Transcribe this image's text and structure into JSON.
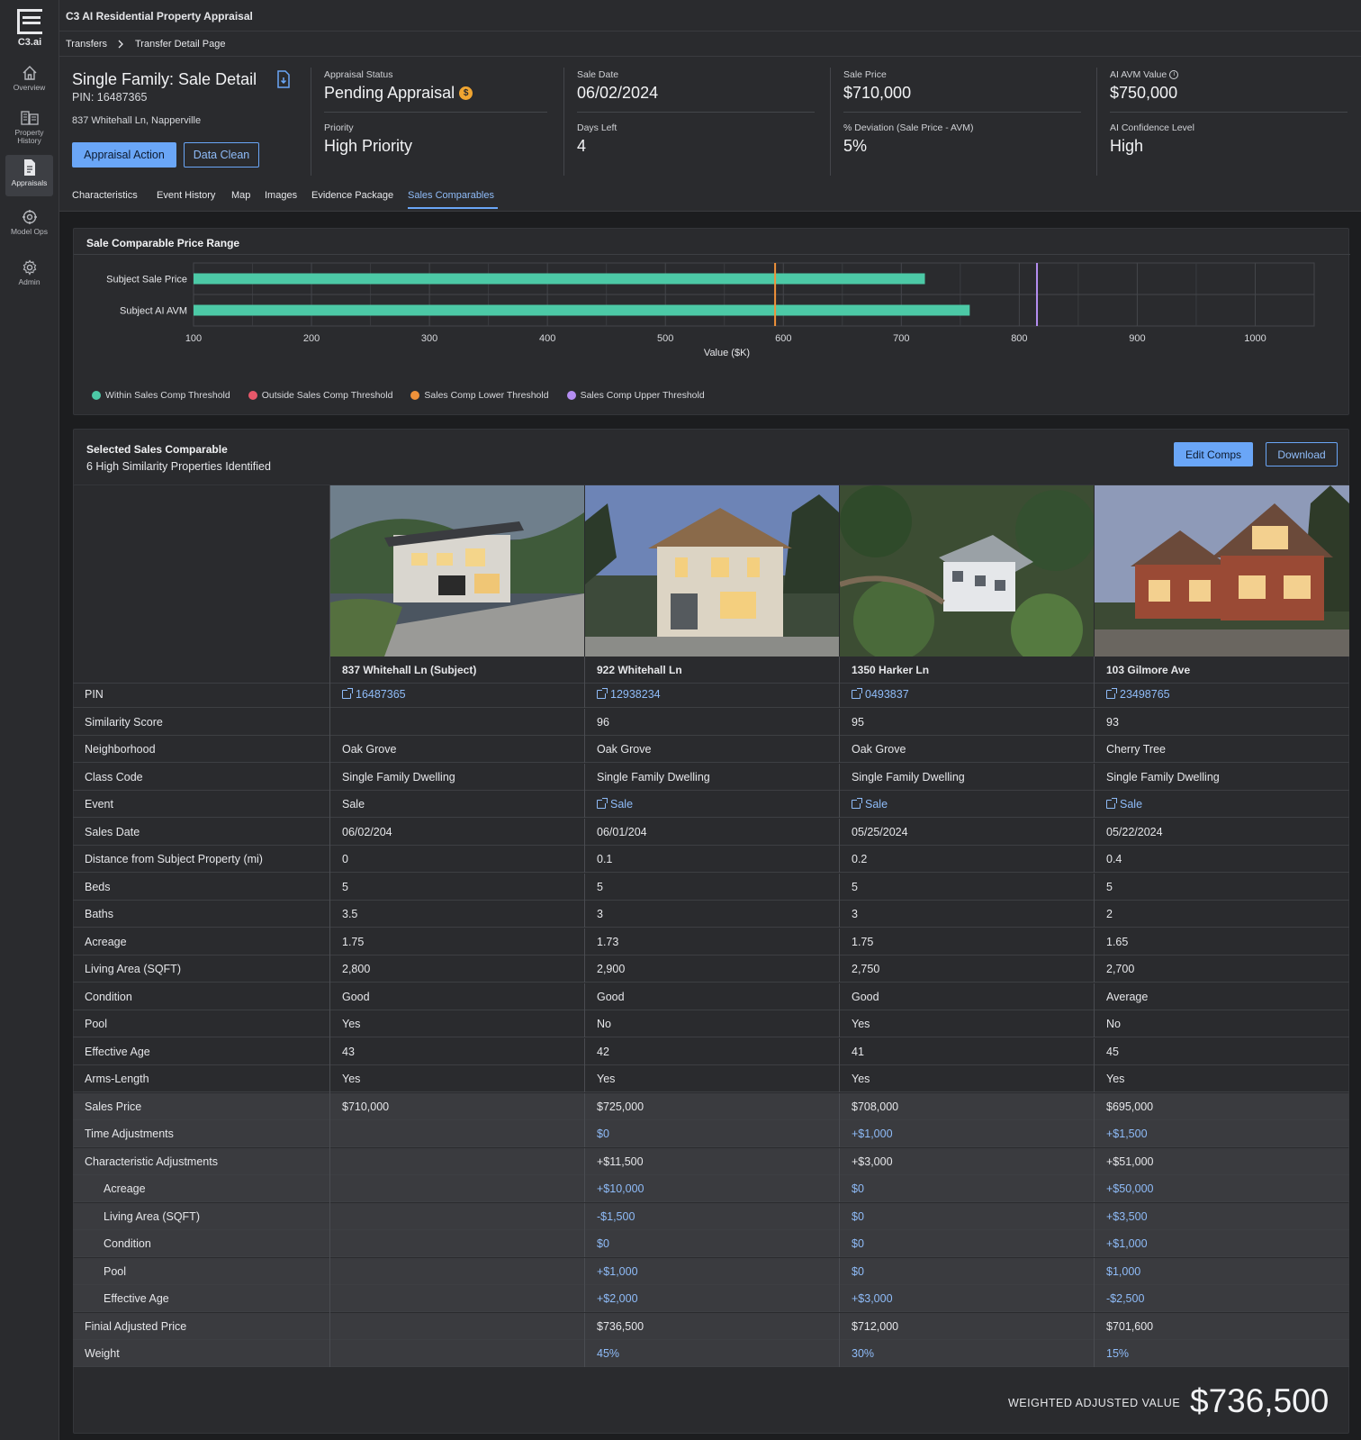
{
  "app": {
    "logo_text": "C3.ai",
    "title": "C3 AI Residential Property Appraisal"
  },
  "sidebar": {
    "items": [
      {
        "label": "Overview",
        "icon": "home-icon"
      },
      {
        "label": "Property History",
        "icon": "building-icon"
      },
      {
        "label": "Appraisals",
        "icon": "document-icon",
        "active": true
      },
      {
        "label": "Model Ops",
        "icon": "model-ops-icon"
      },
      {
        "label": "Admin",
        "icon": "gear-icon"
      }
    ]
  },
  "breadcrumb": {
    "items": [
      "Transfers",
      "Transfer Detail Page"
    ]
  },
  "property": {
    "title": "Single Family: Sale Detail",
    "pin": "PIN: 16487365",
    "address": "837 Whitehall Ln, Napperville",
    "actions": {
      "appraisal_action": "Appraisal Action",
      "data_clean": "Data Clean"
    }
  },
  "kpis": {
    "appraisal_status": {
      "label": "Appraisal Status",
      "value": "Pending Appraisal",
      "badge": "$"
    },
    "priority": {
      "label": "Priority",
      "value": "High Priority"
    },
    "sale_date": {
      "label": "Sale Date",
      "value": "06/02/2024"
    },
    "days_left": {
      "label": "Days Left",
      "value": "4"
    },
    "sale_price": {
      "label": "Sale Price",
      "value": "$710,000"
    },
    "deviation": {
      "label": "% Deviation (Sale Price - AVM)",
      "value": "5%"
    },
    "avm_value": {
      "label": "AI AVM Value",
      "value": "$750,000"
    },
    "confidence": {
      "label": "AI Confidence Level",
      "value": "High"
    }
  },
  "tabs": [
    "Characteristics",
    "Event History",
    "Map",
    "Images",
    "Evidence Package",
    "Sales Comparables"
  ],
  "active_tab": "Sales Comparables",
  "price_range_card": {
    "title": "Sale Comparable Price Range"
  },
  "chart_data": {
    "type": "bar",
    "orientation": "horizontal",
    "title": "Sale Comparable Price Range",
    "categories": [
      "Subject Sale Price",
      "Subject AI AVM"
    ],
    "values": [
      720,
      758
    ],
    "xlabel": "Value ($K)",
    "xlim": [
      100,
      1050
    ],
    "xticks": [
      100,
      200,
      300,
      400,
      500,
      600,
      700,
      800,
      900,
      1000
    ],
    "lower_threshold": 593,
    "upper_threshold": 815,
    "grid": true,
    "legend": [
      {
        "name": "Within Sales Comp Threshold",
        "color": "#4cc9a6"
      },
      {
        "name": "Outside Sales Comp Threshold",
        "color": "#e8586a"
      },
      {
        "name": "Sales Comp Lower Threshold",
        "color": "#f0923a"
      },
      {
        "name": "Sales Comp Upper Threshold",
        "color": "#b58ef2"
      }
    ],
    "legend_position": "bottom-left",
    "bar_color": "#4cc9a6"
  },
  "comps_card": {
    "title": "Selected Sales Comparable",
    "subtitle": "6 High Similarity Properties Identified",
    "edit_button": "Edit Comps",
    "download_button": "Download"
  },
  "comparables": {
    "columns": [
      {
        "name": "837 Whitehall Ln (Subject)",
        "pin": "16487365"
      },
      {
        "name": "922 Whitehall Ln",
        "pin": "12938234"
      },
      {
        "name": "1350 Harker Ln",
        "pin": "0493837"
      },
      {
        "name": "103 Gilmore Ave",
        "pin": "23498765"
      }
    ],
    "rows": [
      {
        "label": "Similarity Score",
        "values": [
          "",
          "96",
          "95",
          "93"
        ]
      },
      {
        "label": "Neighborhood",
        "values": [
          "Oak Grove",
          "Oak Grove",
          "Oak Grove",
          "Cherry Tree"
        ]
      },
      {
        "label": "Class Code",
        "values": [
          "Single Family Dwelling",
          "Single Family Dwelling",
          "Single Family Dwelling",
          "Single Family Dwelling"
        ]
      },
      {
        "label": "Event",
        "values": [
          "Sale",
          "Sale",
          "Sale",
          "Sale"
        ]
      },
      {
        "label": "Sales Date",
        "values": [
          "06/02/204",
          "06/01/204",
          "05/25/2024",
          "05/22/2024"
        ]
      },
      {
        "label": "Distance from Subject Property (mi)",
        "values": [
          "0",
          "0.1",
          "0.2",
          "0.4"
        ]
      },
      {
        "label": "Beds",
        "values": [
          "5",
          "5",
          "5",
          "5"
        ]
      },
      {
        "label": "Baths",
        "values": [
          "3.5",
          "3",
          "3",
          "2"
        ]
      },
      {
        "label": "Acreage",
        "values": [
          "1.75",
          "1.73",
          "1.75",
          "1.65"
        ]
      },
      {
        "label": "Living Area (SQFT)",
        "values": [
          "2,800",
          "2,900",
          "2,750",
          "2,700"
        ]
      },
      {
        "label": "Condition",
        "values": [
          "Good",
          "Good",
          "Good",
          "Average"
        ]
      },
      {
        "label": "Pool",
        "values": [
          "Yes",
          "No",
          "Yes",
          "No"
        ]
      },
      {
        "label": "Effective Age",
        "values": [
          "43",
          "42",
          "41",
          "45"
        ]
      },
      {
        "label": "Arms-Length",
        "values": [
          "Yes",
          "Yes",
          "Yes",
          "Yes"
        ]
      }
    ],
    "adjustment_rows": [
      {
        "label": "Sales Price",
        "values": [
          "$710,000",
          "$725,000",
          "$708,000",
          "$695,000"
        ]
      },
      {
        "label": "Time Adjustments",
        "values": [
          "",
          "$0",
          "+$1,000",
          "+$1,500"
        ]
      },
      {
        "label": "Characteristic Adjustments",
        "values": [
          "",
          "+$11,500",
          "+$3,000",
          "+$51,000"
        ]
      },
      {
        "label": "Acreage",
        "values": [
          "",
          "+$10,000",
          "$0",
          "+$50,000"
        ]
      },
      {
        "label": "Living Area (SQFT)",
        "values": [
          "",
          "-$1,500",
          "$0",
          "+$3,500"
        ]
      },
      {
        "label": "Condition",
        "values": [
          "",
          "$0",
          "$0",
          "+$1,000"
        ]
      },
      {
        "label": "Pool",
        "values": [
          "",
          "+$1,000",
          "$0",
          "$1,000"
        ]
      },
      {
        "label": "Effective Age",
        "values": [
          "",
          "+$2,000",
          "+$3,000",
          "-$2,500"
        ]
      },
      {
        "label": "Finial Adjusted Price",
        "values": [
          "",
          "$736,500",
          "$712,000",
          "$701,600"
        ]
      },
      {
        "label": "Weight",
        "values": [
          "",
          "45%",
          "30%",
          "15%"
        ]
      }
    ]
  },
  "weighted": {
    "label": "WEIGHTED ADJUSTED VALUE",
    "value": "$736,500"
  },
  "colors": {
    "accent": "#6aa6f7",
    "link": "#8fbcf9",
    "background": "#1c1d1f",
    "panel": "#2a2b2e"
  }
}
